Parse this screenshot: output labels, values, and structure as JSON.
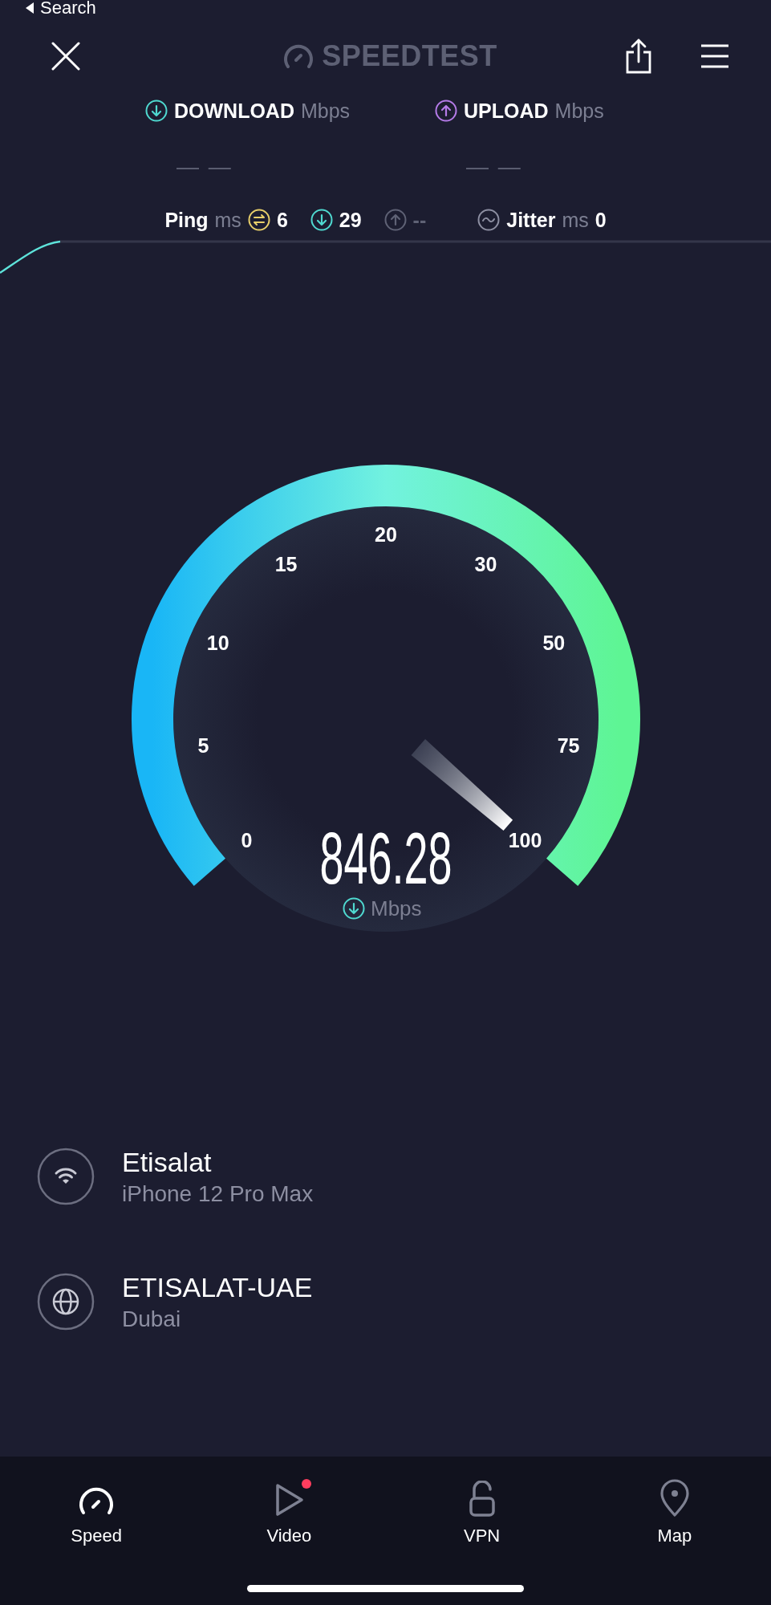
{
  "status_bar": {
    "back_label": "Search"
  },
  "header": {
    "title": "SPEEDTEST"
  },
  "results": [
    {
      "kind": "download",
      "label": "DOWNLOAD",
      "unit": "Mbps",
      "value": "— —"
    },
    {
      "kind": "upload",
      "label": "UPLOAD",
      "unit": "Mbps",
      "value": "— —"
    }
  ],
  "latency": {
    "ping_label": "Ping",
    "ping_unit": "ms",
    "readings": [
      {
        "kind": "idle",
        "value": "6"
      },
      {
        "kind": "download",
        "value": "29"
      },
      {
        "kind": "upload",
        "value": "--"
      }
    ],
    "jitter_label": "Jitter",
    "jitter_unit": "ms",
    "jitter_value": "0"
  },
  "gauge": {
    "ticks": [
      "0",
      "5",
      "10",
      "15",
      "20",
      "30",
      "50",
      "75",
      "100"
    ],
    "value": "846.28",
    "unit": "Mbps"
  },
  "connection": [
    {
      "kind": "wifi",
      "name": "Etisalat",
      "detail": "iPhone 12 Pro Max"
    },
    {
      "kind": "server",
      "name": "ETISALAT-UAE",
      "detail": "Dubai"
    }
  ],
  "tabs": [
    {
      "kind": "speed",
      "label": "Speed",
      "selected": true,
      "badge": false
    },
    {
      "kind": "video",
      "label": "Video",
      "selected": false,
      "badge": true
    },
    {
      "kind": "vpn",
      "label": "VPN",
      "selected": false,
      "badge": false
    },
    {
      "kind": "map",
      "label": "Map",
      "selected": false,
      "badge": false
    }
  ]
}
